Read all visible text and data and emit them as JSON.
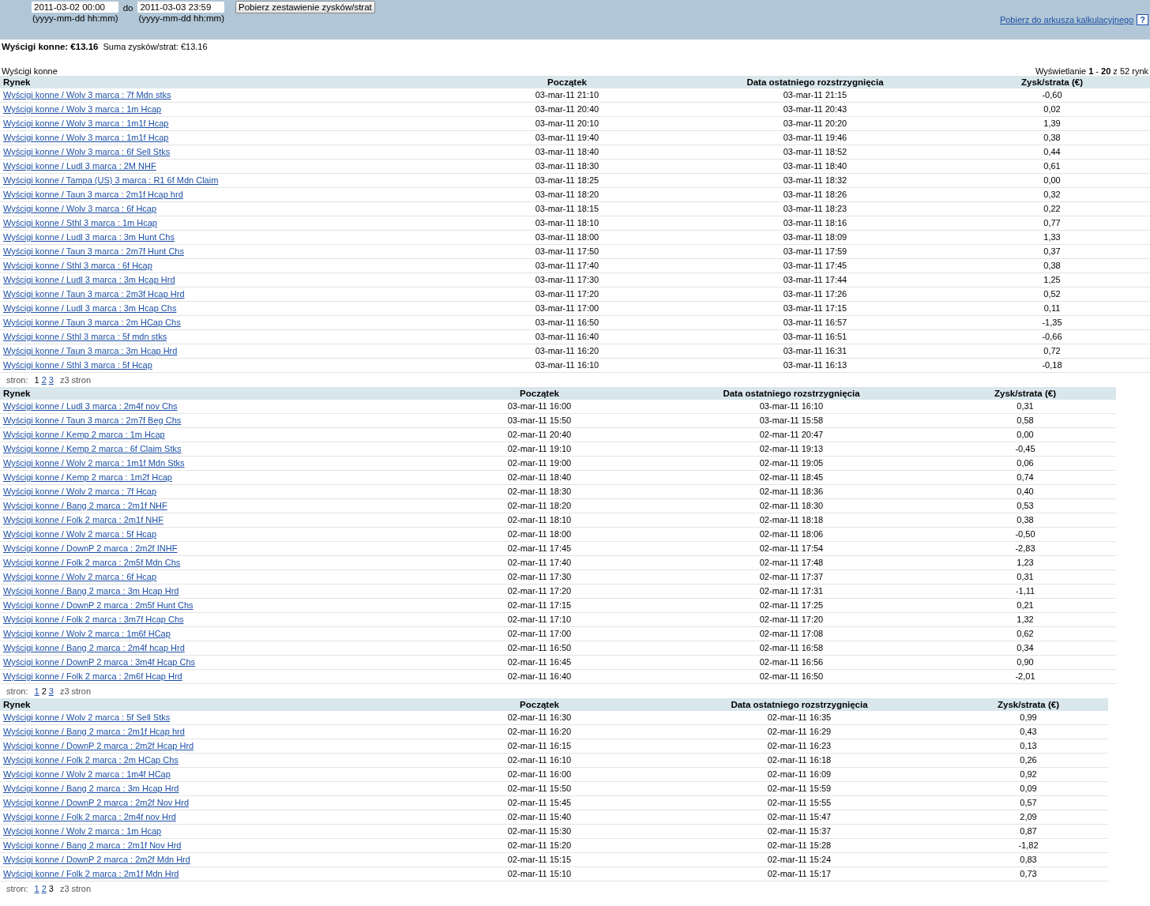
{
  "filter": {
    "from": {
      "value": "2011-03-02 00:00",
      "hint": "(yyyy-mm-dd hh:mm)"
    },
    "separator": "do",
    "to": {
      "value": "2011-03-03 23:59",
      "hint": "(yyyy-mm-dd hh:mm)"
    },
    "button": "Pobierz zestawienie zysków/strat",
    "export_link": "Pobierz do arkusza kalkulacyjnego",
    "help": "?"
  },
  "summary": {
    "title": "Wyścigi konne: €13.16",
    "total": "Suma zysków/strat:  €13.16"
  },
  "section_title": "Wyścigi konne",
  "showing": "Wyświetlanie **1** - **20** z 52 rynk",
  "tables": [
    {
      "columns": [
        "Rynek",
        "Początek",
        "Data ostatniego rozstrzygnięcia",
        "Zysk/strata (€)"
      ],
      "rows": [
        [
          "Wyścigi konne / Wolv 3 marca : 7f Mdn stks",
          "03-mar-11 21:10",
          "03-mar-11 21:15",
          "-0,60"
        ],
        [
          "Wyścigi konne / Wolv 3 marca : 1m Hcap",
          "03-mar-11 20:40",
          "03-mar-11 20:43",
          "0,02"
        ],
        [
          "Wyścigi konne / Wolv 3 marca : 1m1f Hcap",
          "03-mar-11 20:10",
          "03-mar-11 20:20",
          "1,39"
        ],
        [
          "Wyścigi konne / Wolv 3 marca : 1m1f Hcap",
          "03-mar-11 19:40",
          "03-mar-11 19:46",
          "0,38"
        ],
        [
          "Wyścigi konne / Wolv 3 marca : 6f Sell Stks",
          "03-mar-11 18:40",
          "03-mar-11 18:52",
          "0,44"
        ],
        [
          "Wyścigi konne / Ludl 3 marca : 2M NHF",
          "03-mar-11 18:30",
          "03-mar-11 18:40",
          "0,61"
        ],
        [
          "Wyścigi konne / Tampa (US) 3 marca : R1 6f Mdn Claim",
          "03-mar-11 18:25",
          "03-mar-11 18:32",
          "0,00"
        ],
        [
          "Wyścigi konne / Taun 3 marca : 2m1f Hcap hrd",
          "03-mar-11 18:20",
          "03-mar-11 18:26",
          "0,32"
        ],
        [
          "Wyścigi konne / Wolv 3 marca : 6f Hcap",
          "03-mar-11 18:15",
          "03-mar-11 18:23",
          "0,22"
        ],
        [
          "Wyścigi konne / Sthl 3 marca : 1m Hcap",
          "03-mar-11 18:10",
          "03-mar-11 18:16",
          "0,77"
        ],
        [
          "Wyścigi konne / Ludl 3 marca : 3m Hunt Chs",
          "03-mar-11 18:00",
          "03-mar-11 18:09",
          "1,33"
        ],
        [
          "Wyścigi konne / Taun 3 marca : 2m7f Hunt Chs",
          "03-mar-11 17:50",
          "03-mar-11 17:59",
          "0,37"
        ],
        [
          "Wyścigi konne / Sthl 3 marca : 6f Hcap",
          "03-mar-11 17:40",
          "03-mar-11 17:45",
          "0,38"
        ],
        [
          "Wyścigi konne / Ludl 3 marca : 3m Hcap Hrd",
          "03-mar-11 17:30",
          "03-mar-11 17:44",
          "1,25"
        ],
        [
          "Wyścigi konne / Taun 3 marca : 2m3f Hcap Hrd",
          "03-mar-11 17:20",
          "03-mar-11 17:26",
          "0,52"
        ],
        [
          "Wyścigi konne / Ludl 3 marca : 3m Hcap Chs",
          "03-mar-11 17:00",
          "03-mar-11 17:15",
          "0,11"
        ],
        [
          "Wyścigi konne / Taun 3 marca : 2m HCap Chs",
          "03-mar-11 16:50",
          "03-mar-11 16:57",
          "-1,35"
        ],
        [
          "Wyścigi konne / Sthl 3 marca : 5f mdn stks",
          "03-mar-11 16:40",
          "03-mar-11 16:51",
          "-0,66"
        ],
        [
          "Wyścigi konne / Taun 3 marca : 3m Hcap Hrd",
          "03-mar-11 16:20",
          "03-mar-11 16:31",
          "0,72"
        ],
        [
          "Wyścigi konne / Sthl 3 marca : 5f Hcap",
          "03-mar-11 16:10",
          "03-mar-11 16:13",
          "-0,18"
        ]
      ],
      "pager": {
        "label": "stron:",
        "pages": [
          {
            "label": "1",
            "selected": true
          },
          {
            "label": "2",
            "selected": false
          },
          {
            "label": "3",
            "selected": false
          }
        ],
        "total": "z3 stron"
      }
    },
    {
      "columns": [
        "Rynek",
        "Początek",
        "Data ostatniego rozstrzygnięcia",
        "Zysk/strata (€)"
      ],
      "rows": [
        [
          "Wyścigi konne / Ludl 3 marca : 2m4f nov Chs",
          "03-mar-11 16:00",
          "03-mar-11 16:10",
          "0,31"
        ],
        [
          "Wyścigi konne / Taun 3 marca : 2m7f Beg Chs",
          "03-mar-11 15:50",
          "03-mar-11 15:58",
          "0,58"
        ],
        [
          "Wyścigi konne / Kemp 2 marca : 1m Hcap",
          "02-mar-11 20:40",
          "02-mar-11 20:47",
          "0,00"
        ],
        [
          "Wyścigi konne / Kemp 2 marca : 6f Claim Stks",
          "02-mar-11 19:10",
          "02-mar-11 19:13",
          "-0,45"
        ],
        [
          "Wyścigi konne / Wolv 2 marca : 1m1f Mdn Stks",
          "02-mar-11 19:00",
          "02-mar-11 19:05",
          "0,06"
        ],
        [
          "Wyścigi konne / Kemp 2 marca : 1m2f Hcap",
          "02-mar-11 18:40",
          "02-mar-11 18:45",
          "0,74"
        ],
        [
          "Wyścigi konne / Wolv 2 marca : 7f Hcap",
          "02-mar-11 18:30",
          "02-mar-11 18:36",
          "0,40"
        ],
        [
          "Wyścigi konne / Bang 2 marca : 2m1f NHF",
          "02-mar-11 18:20",
          "02-mar-11 18:30",
          "0,53"
        ],
        [
          "Wyścigi konne / Folk 2 marca : 2m1f NHF",
          "02-mar-11 18:10",
          "02-mar-11 18:18",
          "0,38"
        ],
        [
          "Wyścigi konne / Wolv 2 marca : 5f Hcap",
          "02-mar-11 18:00",
          "02-mar-11 18:06",
          "-0,50"
        ],
        [
          "Wyścigi konne / DownP 2 marca : 2m2f INHF",
          "02-mar-11 17:45",
          "02-mar-11 17:54",
          "-2,83"
        ],
        [
          "Wyścigi konne / Folk 2 marca : 2m5f Mdn Chs",
          "02-mar-11 17:40",
          "02-mar-11 17:48",
          "1,23"
        ],
        [
          "Wyścigi konne / Wolv 2 marca : 6f Hcap",
          "02-mar-11 17:30",
          "02-mar-11 17:37",
          "0,31"
        ],
        [
          "Wyścigi konne / Bang 2 marca : 3m Hcap Hrd",
          "02-mar-11 17:20",
          "02-mar-11 17:31",
          "-1,11"
        ],
        [
          "Wyścigi konne / DownP 2 marca : 2m5f Hunt Chs",
          "02-mar-11 17:15",
          "02-mar-11 17:25",
          "0,21"
        ],
        [
          "Wyścigi konne / Folk 2 marca : 3m7f Hcap Chs",
          "02-mar-11 17:10",
          "02-mar-11 17:20",
          "1,32"
        ],
        [
          "Wyścigi konne / Wolv 2 marca : 1m6f HCap",
          "02-mar-11 17:00",
          "02-mar-11 17:08",
          "0,62"
        ],
        [
          "Wyścigi konne / Bang 2 marca : 2m4f hcap Hrd",
          "02-mar-11 16:50",
          "02-mar-11 16:58",
          "0,34"
        ],
        [
          "Wyścigi konne / DownP 2 marca : 3m4f Hcap Chs",
          "02-mar-11 16:45",
          "02-mar-11 16:56",
          "0,90"
        ],
        [
          "Wyścigi konne / Folk 2 marca : 2m6f Hcap Hrd",
          "02-mar-11 16:40",
          "02-mar-11 16:50",
          "-2,01"
        ]
      ],
      "pager": {
        "label": "stron:",
        "pages": [
          {
            "label": "1",
            "selected": false
          },
          {
            "label": "2",
            "selected": true
          },
          {
            "label": "3",
            "selected": false
          }
        ],
        "total": "z3 stron"
      }
    },
    {
      "columns": [
        "Rynek",
        "Początek",
        "Data ostatniego rozstrzygnięcia",
        "Zysk/strata (€)"
      ],
      "rows": [
        [
          "Wyścigi konne / Wolv 2 marca : 5f Sell Stks",
          "02-mar-11 16:30",
          "02-mar-11 16:35",
          "0,99"
        ],
        [
          "Wyścigi konne / Bang 2 marca : 2m1f Hcap hrd",
          "02-mar-11 16:20",
          "02-mar-11 16:29",
          "0,43"
        ],
        [
          "Wyścigi konne / DownP 2 marca : 2m2f Hcap Hrd",
          "02-mar-11 16:15",
          "02-mar-11 16:23",
          "0,13"
        ],
        [
          "Wyścigi konne / Folk 2 marca : 2m HCap Chs",
          "02-mar-11 16:10",
          "02-mar-11 16:18",
          "0,26"
        ],
        [
          "Wyścigi konne / Wolv 2 marca : 1m4f HCap",
          "02-mar-11 16:00",
          "02-mar-11 16:09",
          "0,92"
        ],
        [
          "Wyścigi konne / Bang 2 marca : 3m Hcap Hrd",
          "02-mar-11 15:50",
          "02-mar-11 15:59",
          "0,09"
        ],
        [
          "Wyścigi konne / DownP 2 marca : 2m2f Nov Hrd",
          "02-mar-11 15:45",
          "02-mar-11 15:55",
          "0,57"
        ],
        [
          "Wyścigi konne / Folk 2 marca : 2m4f nov Hrd",
          "02-mar-11 15:40",
          "02-mar-11 15:47",
          "2,09"
        ],
        [
          "Wyścigi konne / Wolv 2 marca : 1m Hcap",
          "02-mar-11 15:30",
          "02-mar-11 15:37",
          "0,87"
        ],
        [
          "Wyścigi konne / Bang 2 marca : 2m1f Nov Hrd",
          "02-mar-11 15:20",
          "02-mar-11 15:28",
          "-1,82"
        ],
        [
          "Wyścigi konne / DownP 2 marca : 2m2f Mdn Hrd",
          "02-mar-11 15:15",
          "02-mar-11 15:24",
          "0,83"
        ],
        [
          "Wyścigi konne / Folk 2 marca : 2m1f Mdn Hrd",
          "02-mar-11 15:10",
          "02-mar-11 15:17",
          "0,73"
        ]
      ],
      "pager": {
        "label": "stron:",
        "pages": [
          {
            "label": "1",
            "selected": false
          },
          {
            "label": "2",
            "selected": false
          },
          {
            "label": "3",
            "selected": true
          }
        ],
        "total": "z3 stron"
      }
    }
  ]
}
